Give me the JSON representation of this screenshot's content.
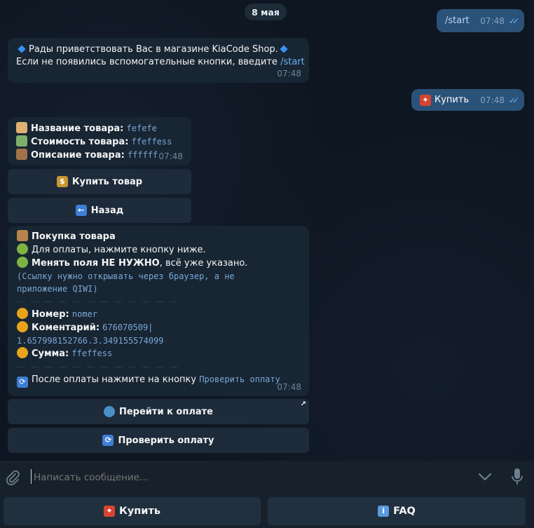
{
  "date_chip": "8 мая",
  "msg_start": {
    "text": "/start",
    "time": "07:48"
  },
  "msg_welcome": {
    "line1": "Рады приветствовать Вас в магазине KiaCode Shop.",
    "line2_prefix": "Если не появились вспомогательные кнопки, введите",
    "line2_link": "/start",
    "time": "07:48"
  },
  "msg_buy": {
    "text": "Купить",
    "time": "07:48"
  },
  "msg_product": {
    "name_label": "Название товара:",
    "name_value": "fefefe",
    "price_label": "Стоимость товара:",
    "price_value": "ffeffess",
    "desc_label": "Описание товара:",
    "desc_value": "ffffff",
    "time": "07:48"
  },
  "inline_buttons_product": {
    "buy": "Купить товар",
    "back": "Назад"
  },
  "msg_purchase": {
    "title": "Покупка товара",
    "line2": "Для оплаты, нажмите кнопку ниже.",
    "line3_bold": "Менять поля НЕ НУЖНО",
    "line3_rest": ", всё уже указано.",
    "note_line1": "(Ссылку нужно открывать через браузер, а не",
    "note_line2": "приложение QIWI)",
    "divider": "— — — — — — — — — — — —",
    "number_label": "Номер:",
    "number_value": "nomer",
    "comment_label": "Коментарий:",
    "comment_value_1": "676070509|",
    "comment_value_2": "1.657998152766.3.349155574099",
    "sum_label": "Сумма:",
    "sum_value": "ffeffess",
    "after_text": "После оплаты нажмите на кнопку",
    "after_code": "Проверить оплату",
    "time": "07:48"
  },
  "inline_buttons_purchase": {
    "pay": "Перейти к оплате",
    "check": "Проверить оплату"
  },
  "composer": {
    "placeholder": "Написать сообщение..."
  },
  "reply_keyboard": {
    "buy": "Купить",
    "faq": "FAQ"
  },
  "colors": {
    "background": "#0e1621",
    "bubble_out": "#2b5278",
    "bubble_in": "#182533",
    "accent": "#6ab2f2"
  }
}
